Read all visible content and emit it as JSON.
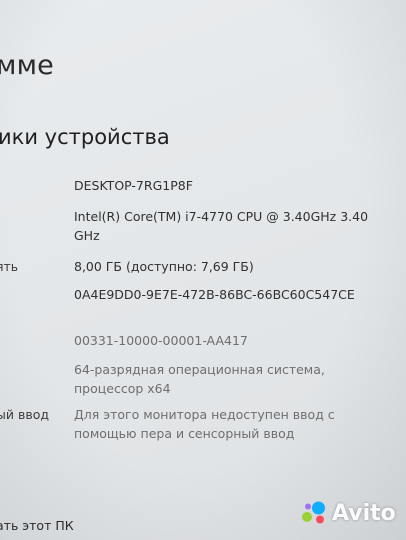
{
  "page": {
    "title": "мме",
    "section_title": "ики устройства"
  },
  "specs": [
    {
      "label": "",
      "value": "DESKTOP-7RG1P8F"
    },
    {
      "label": "",
      "value": "Intel(R) Core(TM) i7-4770 CPU @ 3.40GHz 3.40 GHz"
    },
    {
      "label": "ять",
      "value": "8,00 ГБ (доступно: 7,69 ГБ)"
    },
    {
      "label": "",
      "value": "0A4E9DD0-9E7E-472B-86BC-66BC60C547CE"
    },
    {
      "label": "",
      "value": "00331-10000-00001-AA417"
    },
    {
      "label": "",
      "value": "64-разрядная операционная система, процессор x64"
    },
    {
      "label": "ый ввод",
      "value": "Для этого монитора недоступен ввод с помощью пера и сенсорный ввод"
    }
  ],
  "footer": {
    "rename_link": "ать этот ПК"
  },
  "watermark": {
    "brand": "Avito",
    "icon": "avito-logo-icon",
    "colors": {
      "dot_blue": "#00aaff",
      "dot_green": "#97cf26",
      "dot_red": "#ff4053",
      "dot_purple": "#a169f7"
    }
  }
}
